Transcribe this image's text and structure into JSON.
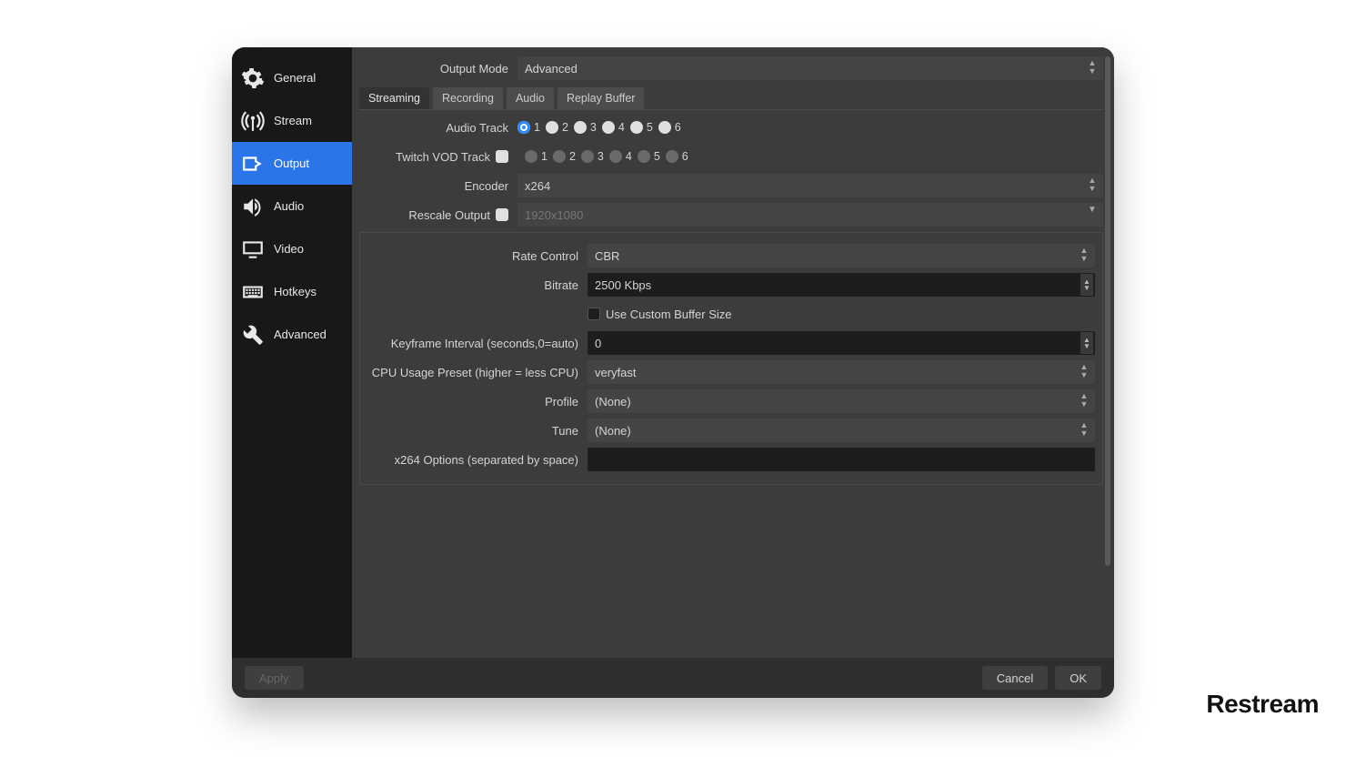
{
  "sidebar": {
    "items": [
      {
        "label": "General"
      },
      {
        "label": "Stream"
      },
      {
        "label": "Output"
      },
      {
        "label": "Audio"
      },
      {
        "label": "Video"
      },
      {
        "label": "Hotkeys"
      },
      {
        "label": "Advanced"
      }
    ],
    "selected_index": 2
  },
  "header": {
    "output_mode_label": "Output Mode",
    "output_mode_value": "Advanced",
    "tabs": [
      "Streaming",
      "Recording",
      "Audio",
      "Replay Buffer"
    ],
    "selected_tab_index": 0
  },
  "streaming": {
    "audio_track_label": "Audio Track",
    "audio_tracks": [
      "1",
      "2",
      "3",
      "4",
      "5",
      "6"
    ],
    "audio_track_selected": 1,
    "twitch_vod_label": "Twitch VOD Track",
    "twitch_vod_enabled": false,
    "twitch_vod_tracks": [
      "1",
      "2",
      "3",
      "4",
      "5",
      "6"
    ],
    "encoder_label": "Encoder",
    "encoder_value": "x264",
    "rescale_label": "Rescale Output",
    "rescale_checked": false,
    "rescale_placeholder": "1920x1080"
  },
  "encoder_settings": {
    "rate_control_label": "Rate Control",
    "rate_control_value": "CBR",
    "bitrate_label": "Bitrate",
    "bitrate_value": "2500 Kbps",
    "custom_buffer_label": "Use Custom Buffer Size",
    "custom_buffer_checked": false,
    "keyframe_label": "Keyframe Interval (seconds,0=auto)",
    "keyframe_value": "0",
    "cpu_preset_label": "CPU Usage Preset (higher = less CPU)",
    "cpu_preset_value": "veryfast",
    "profile_label": "Profile",
    "profile_value": "(None)",
    "tune_label": "Tune",
    "tune_value": "(None)",
    "x264opts_label": "x264 Options (separated by space)",
    "x264opts_value": ""
  },
  "footer": {
    "apply": "Apply",
    "cancel": "Cancel",
    "ok": "OK"
  },
  "watermark": "Restream"
}
